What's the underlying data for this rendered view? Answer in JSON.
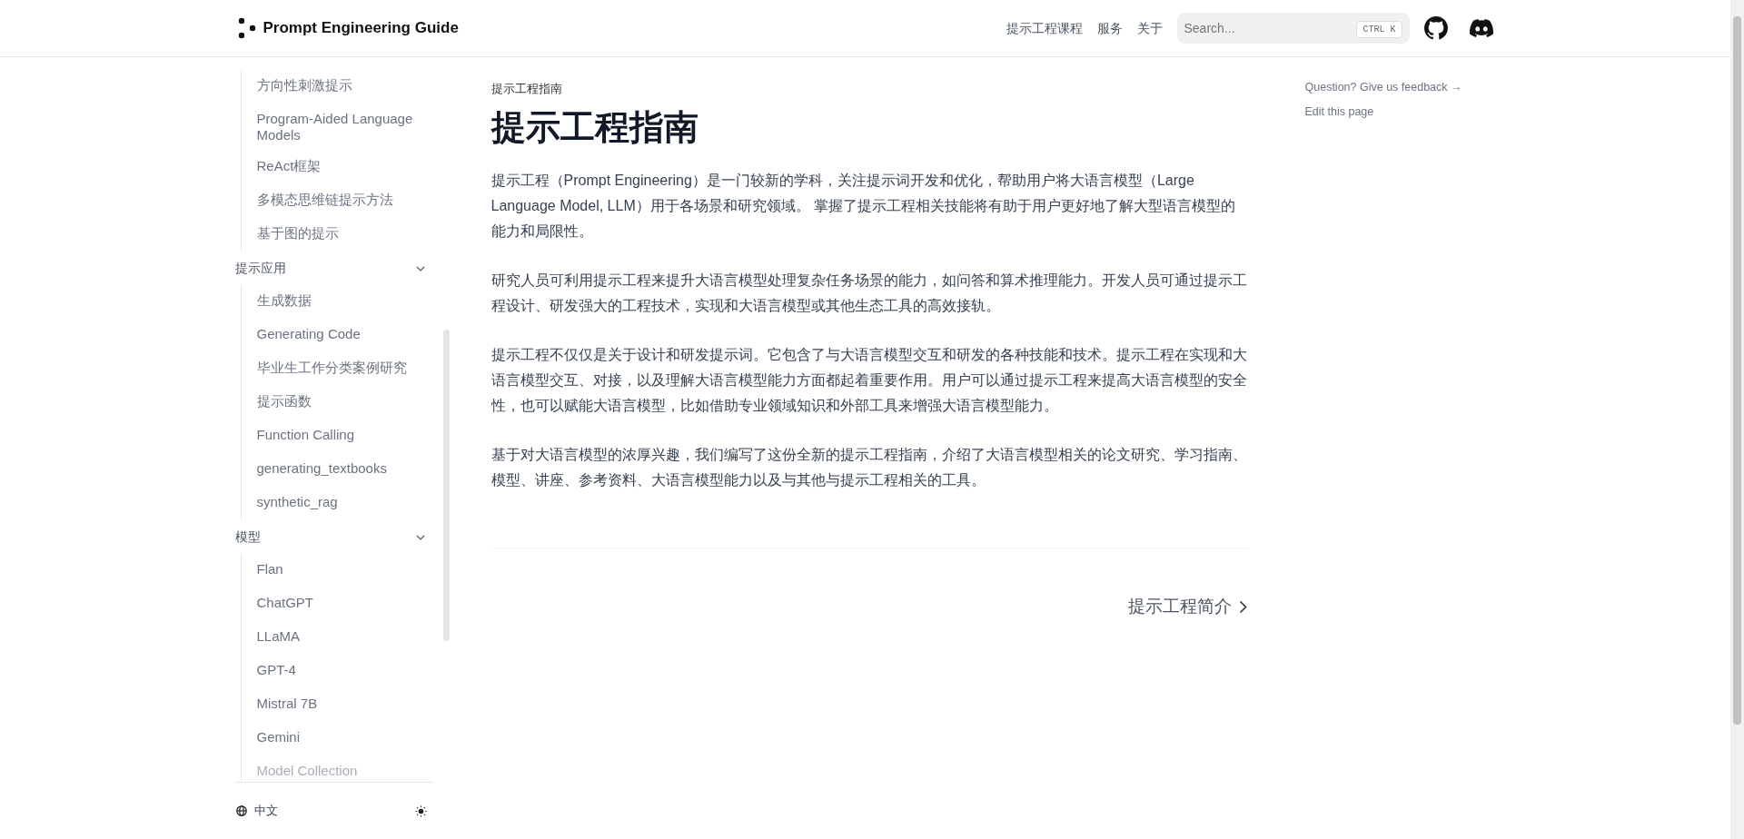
{
  "header": {
    "logo_text": "Prompt Engineering Guide",
    "nav": [
      {
        "label": "提示工程课程"
      },
      {
        "label": "服务"
      },
      {
        "label": "关于"
      }
    ],
    "search": {
      "placeholder": "Search...",
      "shortcut": "CTRL K"
    }
  },
  "sidebar": {
    "groups": [
      {
        "children": [
          {
            "label": "方向性刺激提示"
          },
          {
            "label": "Program-Aided Language Models"
          },
          {
            "label": "ReAct框架"
          },
          {
            "label": "多模态思维链提示方法"
          },
          {
            "label": "基于图的提示"
          }
        ]
      },
      {
        "title": "提示应用",
        "expanded": true,
        "children": [
          {
            "label": "生成数据"
          },
          {
            "label": "Generating Code"
          },
          {
            "label": "毕业生工作分类案例研究"
          },
          {
            "label": "提示函数"
          },
          {
            "label": "Function Calling"
          },
          {
            "label": "generating_textbooks"
          },
          {
            "label": "synthetic_rag"
          }
        ]
      },
      {
        "title": "模型",
        "expanded": true,
        "children": [
          {
            "label": "Flan"
          },
          {
            "label": "ChatGPT"
          },
          {
            "label": "LLaMA"
          },
          {
            "label": "GPT-4"
          },
          {
            "label": "Mistral 7B"
          },
          {
            "label": "Gemini"
          },
          {
            "label": "Model Collection"
          }
        ]
      }
    ],
    "language": "中文"
  },
  "main": {
    "breadcrumb": "提示工程指南",
    "title": "提示工程指南",
    "paragraphs": [
      "提示工程（Prompt Engineering）是一门较新的学科，关注提示词开发和优化，帮助用户将大语言模型（Large Language Model, LLM）用于各场景和研究领域。 掌握了提示工程相关技能将有助于用户更好地了解大型语言模型的能力和局限性。",
      "研究人员可利用提示工程来提升大语言模型处理复杂任务场景的能力，如问答和算术推理能力。开发人员可通过提示工程设计、研发强大的工程技术，实现和大语言模型或其他生态工具的高效接轨。",
      "提示工程不仅仅是关于设计和研发提示词。它包含了与大语言模型交互和研发的各种技能和技术。提示工程在实现和大语言模型交互、对接，以及理解大语言模型能力方面都起着重要作用。用户可以通过提示工程来提高大语言模型的安全性，也可以赋能大语言模型，比如借助专业领域知识和外部工具来增强大语言模型能力。",
      "基于对大语言模型的浓厚兴趣，我们编写了这份全新的提示工程指南，介绍了大语言模型相关的论文研究、学习指南、模型、讲座、参考资料、大语言模型能力以及与其他与提示工程相关的工具。"
    ],
    "next_link": "提示工程简介"
  },
  "toc": {
    "links": [
      {
        "label": "Question? Give us feedback →"
      },
      {
        "label": "Edit this page"
      }
    ]
  }
}
